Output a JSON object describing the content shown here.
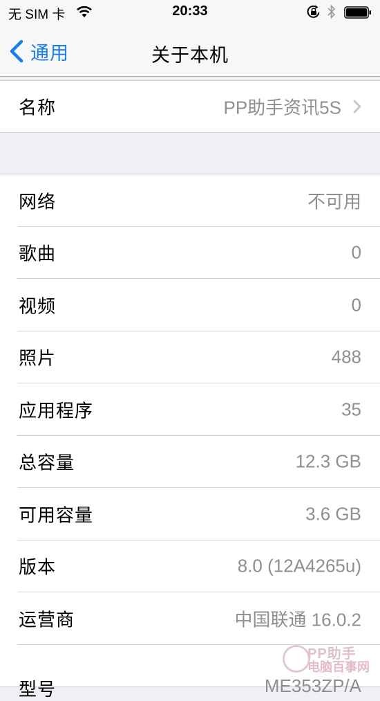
{
  "status_bar": {
    "carrier": "无 SIM 卡",
    "time": "20:33",
    "icons": [
      "wifi-icon",
      "orientation-lock-icon",
      "bluetooth-icon",
      "battery-icon"
    ],
    "battery_level": 1.0
  },
  "nav": {
    "back_label": "通用",
    "title": "关于本机",
    "accent_color": "#1a7ee8"
  },
  "name_cell": {
    "label": "名称",
    "value": "PP助手资讯5S"
  },
  "info_rows": [
    {
      "label": "网络",
      "value": "不可用"
    },
    {
      "label": "歌曲",
      "value": "0"
    },
    {
      "label": "视频",
      "value": "0"
    },
    {
      "label": "照片",
      "value": "488"
    },
    {
      "label": "应用程序",
      "value": "35"
    },
    {
      "label": "总容量",
      "value": "12.3 GB"
    },
    {
      "label": "可用容量",
      "value": "3.6 GB"
    },
    {
      "label": "版本",
      "value": "8.0 (12A4265u)"
    },
    {
      "label": "运营商",
      "value": "中国联通 16.0.2"
    },
    {
      "label": "型号",
      "value": "ME353ZP/A"
    }
  ],
  "watermark": {
    "line1": "PP助手",
    "line2": "电脑百事网"
  }
}
